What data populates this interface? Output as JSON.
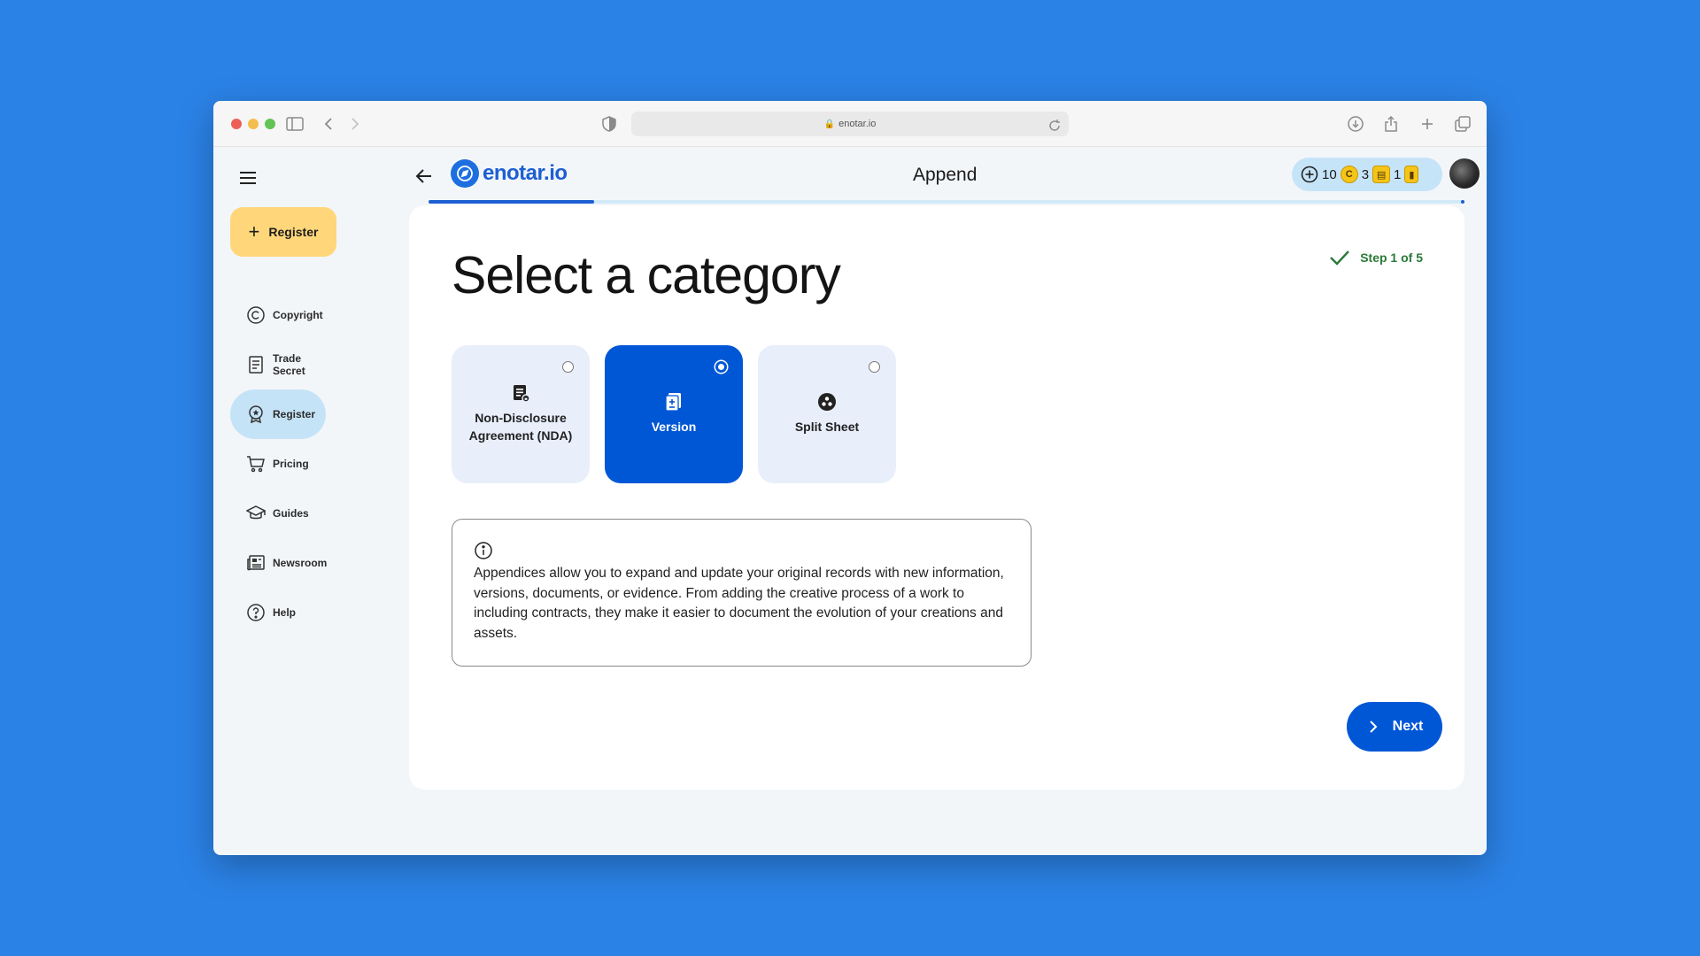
{
  "browser": {
    "url": "enotar.io",
    "icons": [
      "sidebar-icon",
      "back-icon",
      "forward-icon",
      "shield-icon",
      "lock-icon",
      "reload-icon",
      "download-icon",
      "share-icon",
      "new-tab-icon",
      "tabs-icon"
    ]
  },
  "sidebar": {
    "register_label": "Register",
    "items": [
      {
        "label": "Copyright",
        "icon": "copyright-icon",
        "active": false
      },
      {
        "label": "Trade Secret",
        "icon": "document-icon",
        "active": false
      },
      {
        "label": "Register",
        "icon": "badge-icon",
        "active": true
      },
      {
        "label": "Pricing",
        "icon": "cart-icon",
        "active": false
      },
      {
        "label": "Guides",
        "icon": "graduation-cap-icon",
        "active": false
      },
      {
        "label": "Newsroom",
        "icon": "newspaper-icon",
        "active": false
      },
      {
        "label": "Help",
        "icon": "help-icon",
        "active": false
      }
    ]
  },
  "header": {
    "logo_text": "enotar.io",
    "title": "Append",
    "credits": [
      {
        "value": "10",
        "icon": "plus-circle-icon"
      },
      {
        "value": "3",
        "icon": "copyright-coin-icon"
      },
      {
        "value": "1",
        "icon": "badge-coin-icon"
      }
    ]
  },
  "progress": {
    "fraction": 0.16
  },
  "main": {
    "heading": "Select a category",
    "step": "Step 1 of 5",
    "options": [
      {
        "label": "Non-Disclosure Agreement (NDA)",
        "icon": "nda-document-icon",
        "selected": false
      },
      {
        "label": "Version",
        "icon": "version-document-icon",
        "selected": true
      },
      {
        "label": "Split Sheet",
        "icon": "split-sheet-icon",
        "selected": false
      }
    ],
    "info_text": "Appendices allow you to expand and update your original records with new information, versions, documents, or evidence. From adding the creative process of a work to including contracts, they make it easier to document the evolution of your creations and assets.",
    "next_label": "Next"
  },
  "colors": {
    "background": "#2b82e6",
    "primary": "#0057d6",
    "accent_yellow": "#ffd77a",
    "active_nav": "#c5e3f7",
    "success": "#2a7a3a"
  }
}
